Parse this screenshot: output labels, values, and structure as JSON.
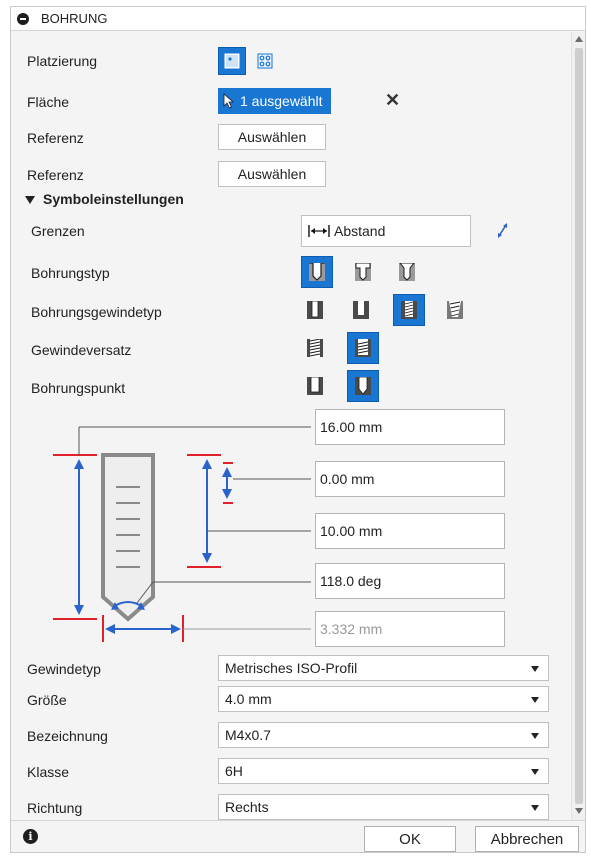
{
  "dialog": {
    "title": "BOHRUNG",
    "collapse_icon": "minus-circle-icon"
  },
  "rows": {
    "placement_label": "Platzierung",
    "face_label": "Fläche",
    "face_selection": "1 ausgewählt",
    "face_clear": "✕",
    "reference1_label": "Referenz",
    "reference1_button": "Auswählen",
    "reference2_label": "Referenz",
    "reference2_button": "Auswählen"
  },
  "symbol_settings": {
    "header": "Symboleinstellungen",
    "extents_label": "Grenzen",
    "extents_value": "Abstand",
    "hole_type_label": "Bohrungstyp",
    "hole_tap_label": "Bohrungsgewindetyp",
    "thread_offset_label": "Gewindeversatz",
    "drill_point_label": "Bohrungspunkt"
  },
  "diagram": {
    "depth": "16.00 mm",
    "thread_offset": "0.00 mm",
    "thread_length": "10.00 mm",
    "point_angle": "118.0 deg",
    "diameter": "3.332 mm"
  },
  "thread": {
    "type_label": "Gewindetyp",
    "type_value": "Metrisches ISO-Profil",
    "size_label": "Größe",
    "size_value": "4.0 mm",
    "designation_label": "Bezeichnung",
    "designation_value": "M4x0.7",
    "class_label": "Klasse",
    "class_value": "6H",
    "direction_label": "Richtung",
    "direction_value": "Rechts"
  },
  "footer": {
    "info_glyph": "i",
    "ok": "OK",
    "cancel": "Abbrechen"
  },
  "colors": {
    "accent": "#1976d2",
    "dimension_blue": "#2a63c9",
    "limit_red": "#e0202a"
  }
}
